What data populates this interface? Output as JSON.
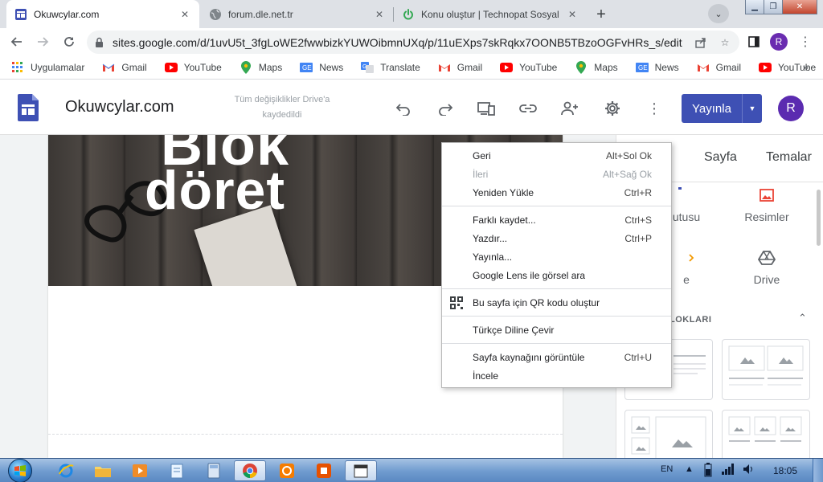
{
  "browser": {
    "tabs": [
      {
        "title": "Okuwcylar.com",
        "icon": "google-sites-favicon"
      },
      {
        "title": "forum.dle.net.tr",
        "icon": "globe-favicon"
      },
      {
        "title": "Konu oluştur | Technopat Sosyal",
        "icon": "power-favicon"
      }
    ],
    "url": "sites.google.com/d/1uvU5t_3fgLoWE2fwwbizkYUWOibmnUXq/p/11uEXps7skRqkx7OONB5TBzoOGFvHRs_s/edit",
    "profile_initial": "R",
    "bookmarks": [
      {
        "label": "Uygulamalar",
        "icon": "apps-grid-icon"
      },
      {
        "label": "Gmail",
        "icon": "gmail-icon"
      },
      {
        "label": "YouTube",
        "icon": "youtube-icon"
      },
      {
        "label": "Maps",
        "icon": "maps-icon"
      },
      {
        "label": "News",
        "icon": "news-icon"
      },
      {
        "label": "Translate",
        "icon": "translate-icon"
      },
      {
        "label": "Gmail",
        "icon": "gmail-icon"
      },
      {
        "label": "YouTube",
        "icon": "youtube-icon"
      },
      {
        "label": "Maps",
        "icon": "maps-icon"
      },
      {
        "label": "News",
        "icon": "news-icon"
      },
      {
        "label": "Gmail",
        "icon": "gmail-icon"
      },
      {
        "label": "YouTube",
        "icon": "youtube-icon"
      }
    ],
    "bookmarks_more": "»"
  },
  "sites": {
    "title": "Okuwcylar.com",
    "save_status": "Tüm değişiklikler Drive'a kaydedildi",
    "publish_label": "Yayınla",
    "avatar_initial": "R",
    "hero_line1": "Blok",
    "hero_line2": "döret",
    "panel_tabs": [
      "Sayfa",
      "Temalar"
    ],
    "panel_items": [
      {
        "label": "utusu"
      },
      {
        "label": "Resimler"
      },
      {
        "label": "e"
      },
      {
        "label": "Drive"
      }
    ],
    "section_title": "LOKLARI",
    "accent": "#3e50b4"
  },
  "context_menu": {
    "groups": [
      [
        {
          "label": "Geri",
          "shortcut": "Alt+Sol Ok",
          "disabled": false
        },
        {
          "label": "İleri",
          "shortcut": "Alt+Sağ Ok",
          "disabled": true
        },
        {
          "label": "Yeniden Yükle",
          "shortcut": "Ctrl+R",
          "disabled": false
        }
      ],
      [
        {
          "label": "Farklı kaydet...",
          "shortcut": "Ctrl+S",
          "disabled": false
        },
        {
          "label": "Yazdır...",
          "shortcut": "Ctrl+P",
          "disabled": false
        },
        {
          "label": "Yayınla...",
          "shortcut": "",
          "disabled": false
        },
        {
          "label": "Google Lens ile görsel ara",
          "shortcut": "",
          "disabled": false
        }
      ],
      [
        {
          "label": "Bu sayfa için QR kodu oluştur",
          "shortcut": "",
          "disabled": false,
          "icon": "qr-code-icon"
        }
      ],
      [
        {
          "label": "Türkçe Diline Çevir",
          "shortcut": "",
          "disabled": false
        }
      ],
      [
        {
          "label": "Sayfa kaynağını görüntüle",
          "shortcut": "Ctrl+U",
          "disabled": false
        },
        {
          "label": "İncele",
          "shortcut": "",
          "disabled": false
        }
      ]
    ]
  },
  "taskbar": {
    "language": "EN",
    "time": "18:05"
  }
}
